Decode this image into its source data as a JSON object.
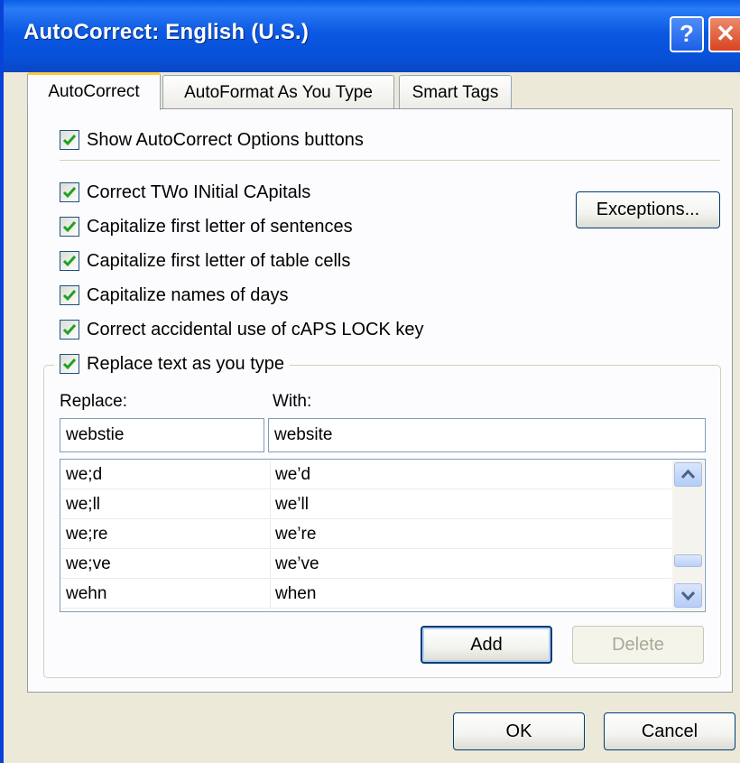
{
  "window": {
    "title": "AutoCorrect: English (U.S.)",
    "help_glyph": "?",
    "close_glyph": "✕"
  },
  "tabs": [
    {
      "label": "AutoCorrect",
      "active": true
    },
    {
      "label": "AutoFormat As You Type",
      "active": false
    },
    {
      "label": "Smart Tags",
      "active": false
    }
  ],
  "options": {
    "show_buttons": {
      "label": "Show AutoCorrect Options buttons",
      "checked": true
    },
    "correct_two_initial": {
      "label": "Correct TWo INitial CApitals",
      "checked": true
    },
    "capitalize_sentences": {
      "label": "Capitalize first letter of sentences",
      "checked": true
    },
    "capitalize_table_cells": {
      "label": "Capitalize first letter of table cells",
      "checked": true
    },
    "capitalize_days": {
      "label": "Capitalize names of days",
      "checked": true
    },
    "caps_lock": {
      "label": "Correct accidental use of cAPS LOCK key",
      "checked": true
    },
    "replace_text": {
      "label": "Replace text as you type",
      "checked": true
    }
  },
  "buttons": {
    "exceptions": "Exceptions...",
    "add": "Add",
    "delete": "Delete",
    "ok": "OK",
    "cancel": "Cancel"
  },
  "replace": {
    "replace_label": "Replace:",
    "with_label": "With:",
    "replace_value": "webstie",
    "with_value": "website",
    "entries": [
      {
        "replace": "we;d",
        "with": "we’d"
      },
      {
        "replace": "we;ll",
        "with": "we’ll"
      },
      {
        "replace": "we;re",
        "with": "we’re"
      },
      {
        "replace": "we;ve",
        "with": "we’ve"
      },
      {
        "replace": "wehn",
        "with": "when"
      }
    ]
  },
  "colors": {
    "titlebar": "#0a5fe8",
    "dialog": "#ece9d8",
    "active_tab_accent": "#ffc83c",
    "check": "#21a121"
  }
}
